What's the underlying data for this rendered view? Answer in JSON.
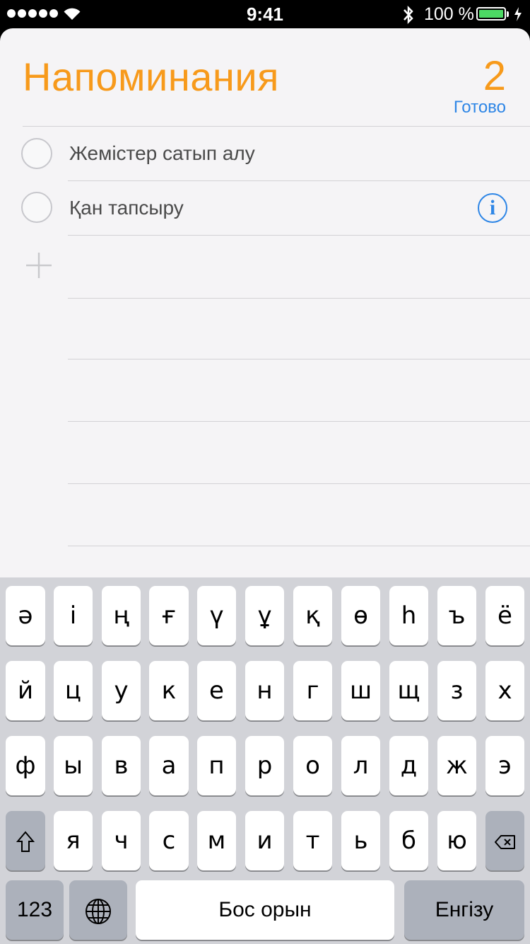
{
  "status_bar": {
    "time": "9:41",
    "battery_percent": "100 %",
    "battery_level": 1.0,
    "battery_color": "#4cd964",
    "signal_dots": 5,
    "icons": [
      "signal-icon",
      "wifi-icon",
      "bluetooth-icon",
      "battery-icon",
      "charging-icon"
    ]
  },
  "reminders": {
    "title": "Напоминания",
    "count": "2",
    "done_label": "Готово",
    "accent_color": "#f79a1b",
    "link_color": "#2e86e6",
    "items": [
      {
        "text": "Жемістер сатып алу",
        "completed": false
      },
      {
        "text": "Қан тапсыру",
        "completed": false,
        "has_info": true
      }
    ],
    "info_glyph": "i",
    "add_icon": "plus-icon"
  },
  "keyboard": {
    "row1": [
      "ә",
      "і",
      "ң",
      "ғ",
      "ү",
      "ұ",
      "қ",
      "ө",
      "һ",
      "ъ",
      "ё"
    ],
    "row2": [
      "й",
      "ц",
      "у",
      "к",
      "е",
      "н",
      "г",
      "ш",
      "щ",
      "з",
      "х"
    ],
    "row3": [
      "ф",
      "ы",
      "в",
      "а",
      "п",
      "р",
      "о",
      "л",
      "д",
      "ж",
      "э"
    ],
    "row4": [
      "я",
      "ч",
      "с",
      "м",
      "и",
      "т",
      "ь",
      "б",
      "ю"
    ],
    "numbers_label": "123",
    "space_label": "Бос орын",
    "return_label": "Енгізу",
    "shift_icon": "shift-icon",
    "delete_icon": "delete-icon",
    "globe_icon": "globe-icon"
  }
}
